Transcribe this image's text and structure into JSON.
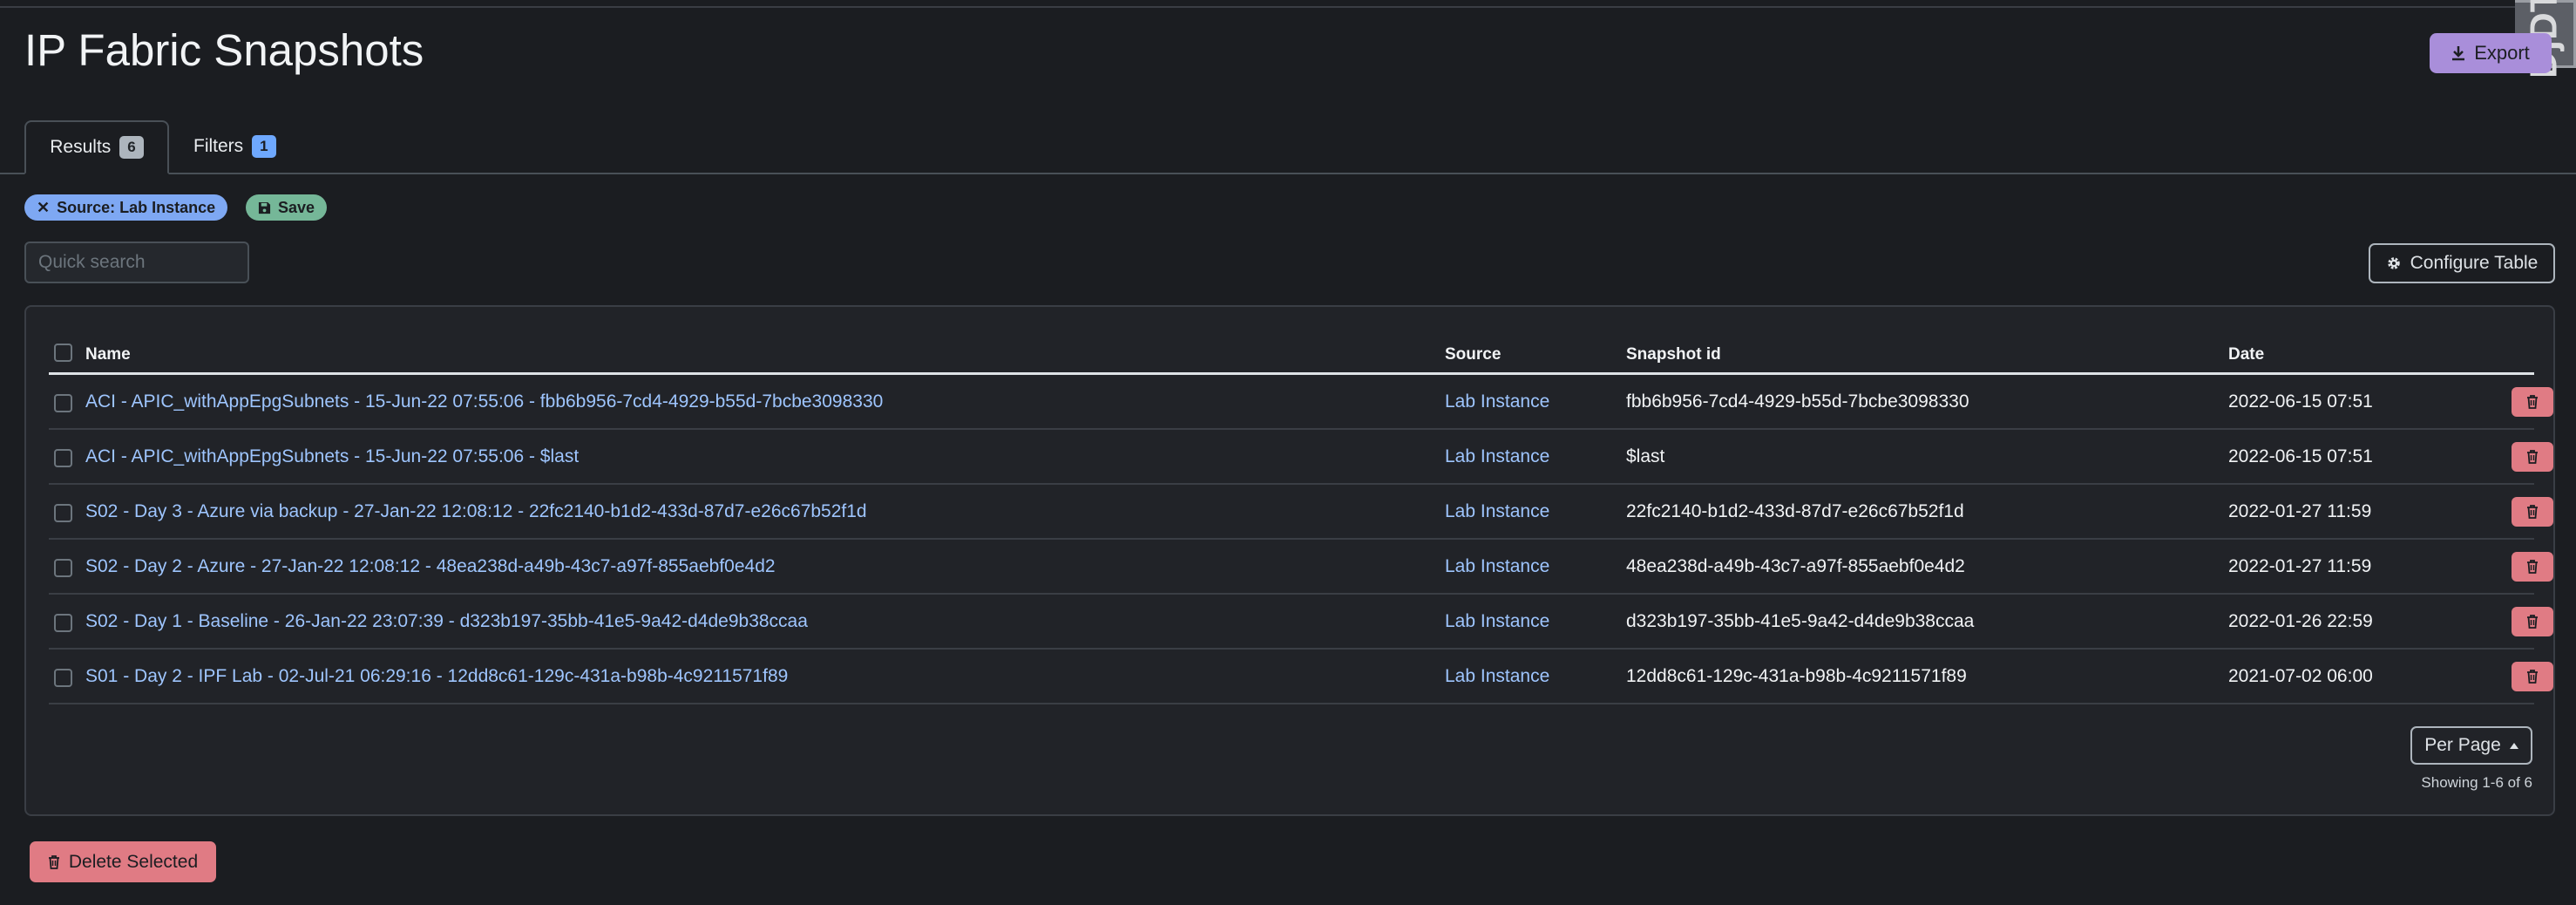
{
  "page": {
    "title": "IP Fabric Snapshots",
    "export_label": "Export",
    "debug_toolbar_label": "DjDT"
  },
  "tabs": [
    {
      "label": "Results",
      "count": "6"
    },
    {
      "label": "Filters",
      "count": "1"
    }
  ],
  "filters": {
    "active_chip": "Source: Lab Instance",
    "save_label": "Save"
  },
  "search": {
    "placeholder": "Quick search",
    "value": ""
  },
  "toolbar": {
    "configure_label": "Configure Table"
  },
  "table": {
    "columns": [
      "Name",
      "Source",
      "Snapshot id",
      "Date"
    ],
    "rows": [
      {
        "name": "ACI - APIC_withAppEpgSubnets - 15-Jun-22 07:55:06 - fbb6b956-7cd4-4929-b55d-7bcbe3098330",
        "source": "Lab Instance",
        "snapshot_id": "fbb6b956-7cd4-4929-b55d-7bcbe3098330",
        "date": "2022-06-15 07:51"
      },
      {
        "name": "ACI - APIC_withAppEpgSubnets - 15-Jun-22 07:55:06 - $last",
        "source": "Lab Instance",
        "snapshot_id": "$last",
        "date": "2022-06-15 07:51"
      },
      {
        "name": "S02 - Day 3 - Azure via backup - 27-Jan-22 12:08:12 - 22fc2140-b1d2-433d-87d7-e26c67b52f1d",
        "source": "Lab Instance",
        "snapshot_id": "22fc2140-b1d2-433d-87d7-e26c67b52f1d",
        "date": "2022-01-27 11:59"
      },
      {
        "name": "S02 - Day 2 - Azure - 27-Jan-22 12:08:12 - 48ea238d-a49b-43c7-a97f-855aebf0e4d2",
        "source": "Lab Instance",
        "snapshot_id": "48ea238d-a49b-43c7-a97f-855aebf0e4d2",
        "date": "2022-01-27 11:59"
      },
      {
        "name": "S02 - Day 1 - Baseline - 26-Jan-22 23:07:39 - d323b197-35bb-41e5-9a42-d4de9b38ccaa",
        "source": "Lab Instance",
        "snapshot_id": "d323b197-35bb-41e5-9a42-d4de9b38ccaa",
        "date": "2022-01-26 22:59"
      },
      {
        "name": "S01 - Day 2 - IPF Lab - 02-Jul-21 06:29:16 - 12dd8c61-129c-431a-b98b-4c9211571f89",
        "source": "Lab Instance",
        "snapshot_id": "12dd8c61-129c-431a-b98b-4c9211571f89",
        "date": "2021-07-02 06:00"
      }
    ]
  },
  "pagination": {
    "per_page_label": "Per Page",
    "showing": "Showing 1-6 of 6"
  },
  "actions": {
    "delete_selected": "Delete Selected"
  },
  "colors": {
    "accent_purple": "#a98eda",
    "link_blue": "#9ec5fe",
    "danger": "#e07b84",
    "chip_blue": "#7ea8f3",
    "chip_green": "#75b798"
  }
}
